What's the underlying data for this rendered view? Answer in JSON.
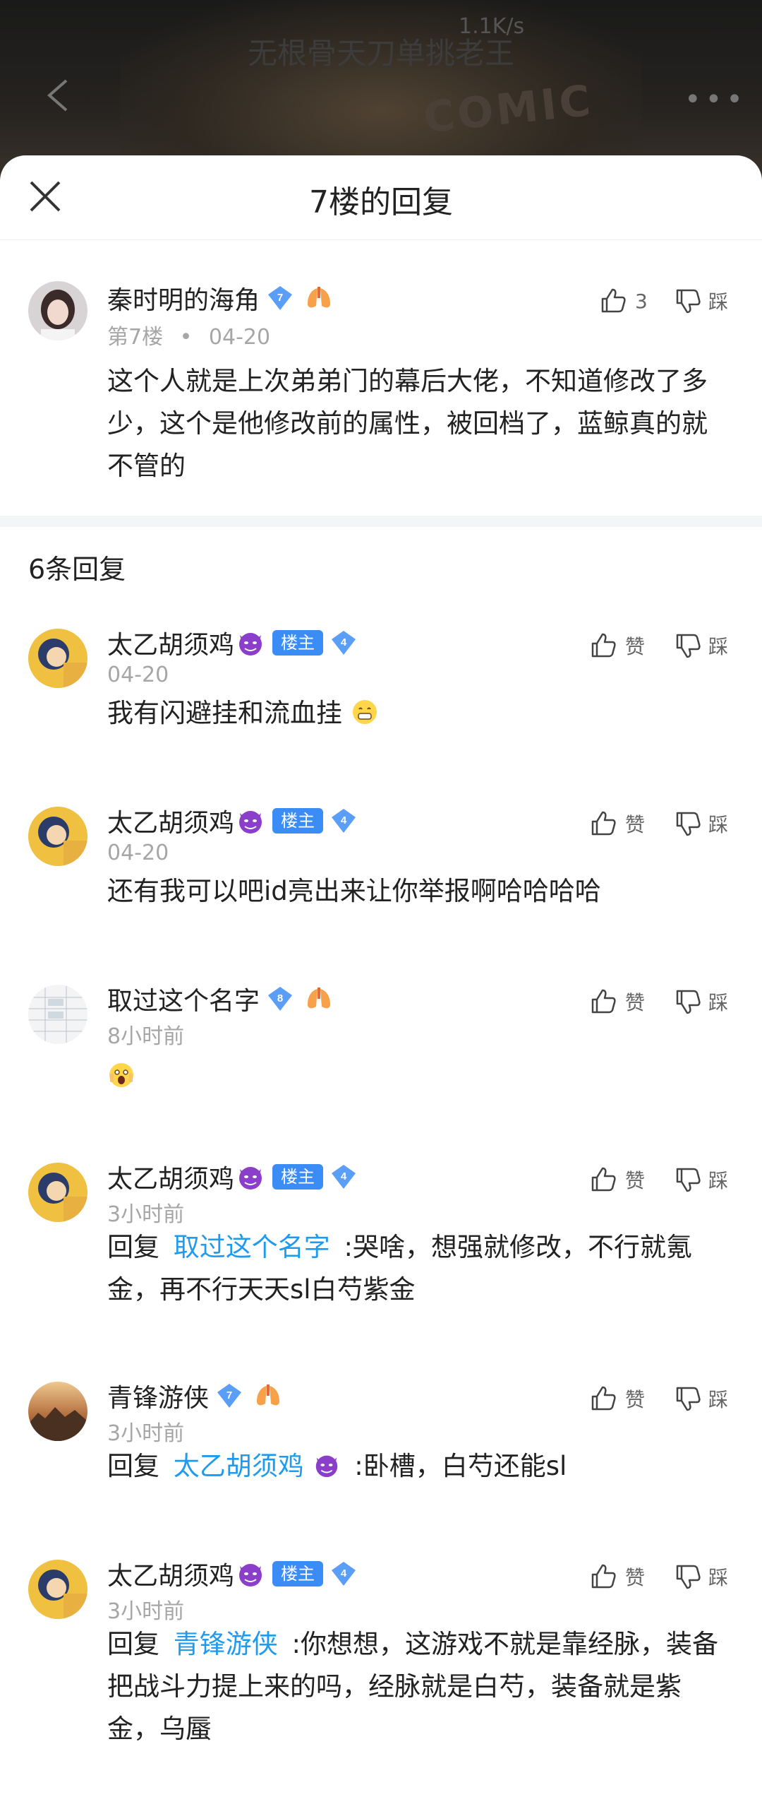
{
  "background": {
    "title": "无根骨天刀单挑老王",
    "speed": "1.1K/s",
    "art_text": "COMIC"
  },
  "sheet": {
    "title": "7楼的回复"
  },
  "main_comment": {
    "user": "秦时明的海角",
    "level": "7",
    "floor": "第7楼",
    "separator": "•",
    "date": "04-20",
    "text": "这个人就是上次弟弟门的幕后大佬，不知道修改了多少，这个是他修改前的属性，被回档了，蓝鲸真的就不管的",
    "likes": "3",
    "dislike_label": "踩"
  },
  "reply_count": "6条回复",
  "replies": [
    {
      "user": "太乙胡须鸡",
      "badge": "楼主",
      "level": "4",
      "time": "04-20",
      "text": "我有闪避挂和流血挂",
      "like_label": "赞",
      "dislike_label": "踩"
    },
    {
      "user": "太乙胡须鸡",
      "badge": "楼主",
      "level": "4",
      "time": "04-20",
      "text": "还有我可以吧id亮出来让你举报啊哈哈哈哈",
      "like_label": "赞",
      "dislike_label": "踩"
    },
    {
      "user": "取过这个名字",
      "level": "8",
      "time": "8小时前",
      "text": "",
      "like_label": "赞",
      "dislike_label": "踩"
    },
    {
      "user": "太乙胡须鸡",
      "badge": "楼主",
      "level": "4",
      "time": "3小时前",
      "reply_prefix": "回复",
      "reply_to": "取过这个名字",
      "text": ":哭啥，想强就修改，不行就氪金，再不行天天sl白芍紫金",
      "like_label": "赞",
      "dislike_label": "踩"
    },
    {
      "user": "青锋游侠",
      "level": "7",
      "time": "3小时前",
      "reply_prefix": "回复",
      "reply_to": "太乙胡须鸡",
      "text": ":卧槽，白芍还能sl",
      "like_label": "赞",
      "dislike_label": "踩"
    },
    {
      "user": "太乙胡须鸡",
      "badge": "楼主",
      "level": "4",
      "time": "3小时前",
      "reply_prefix": "回复",
      "reply_to": "青锋游侠",
      "text": ":你想想，这游戏不就是靠经脉，装备把战斗力提上来的吗，经脉就是白芍，装备就是紫金，乌蜃",
      "like_label": "赞",
      "dislike_label": "踩"
    }
  ],
  "colors": {
    "accent_link": "#1e9bef",
    "host_badge": "#3b8cf5",
    "level_diamond": "#5b9ef7",
    "meta_gray": "#a6a6a6"
  }
}
